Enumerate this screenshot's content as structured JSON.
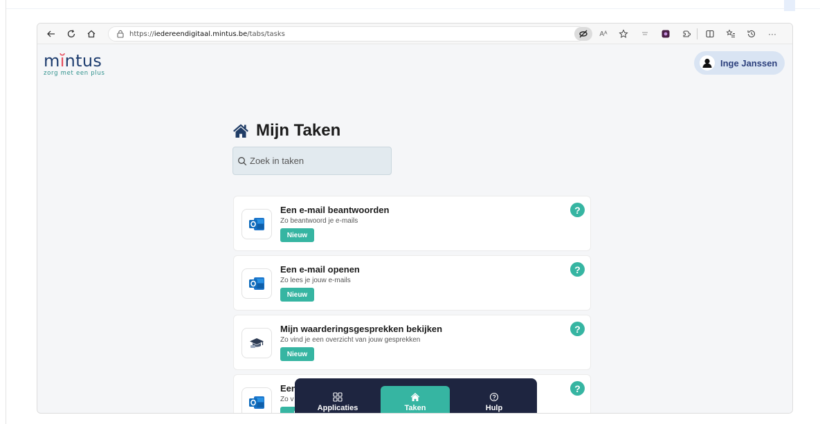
{
  "browser": {
    "url_prefix": "https://",
    "url_host": "iedereendigitaal.mintus.be",
    "url_path": "/tabs/tasks",
    "read_aloud_label": "Aᴬ",
    "more_label": "···"
  },
  "brand": {
    "logo_pre": "m",
    "logo_accent": "ĭ",
    "logo_post": "ntus",
    "tagline": "zorg met een plus",
    "navy": "#1d3c6e",
    "red": "#e64b5b",
    "teal": "#36b5a2"
  },
  "user": {
    "name": "Inge Janssen"
  },
  "page": {
    "title": "Mijn Taken",
    "search_placeholder": "Zoek in taken"
  },
  "tasks": [
    {
      "title": "Een e-mail beantwoorden",
      "subtitle": "Zo beantwoord je e-mails",
      "badge": "Nieuw",
      "icon": "outlook-icon"
    },
    {
      "title": "Een e-mail openen",
      "subtitle": "Zo lees je jouw e-mails",
      "badge": "Nieuw",
      "icon": "outlook-icon"
    },
    {
      "title": "Mijn waarderingsgesprekken bekijken",
      "subtitle": "Zo vind je een overzicht van jouw gesprekken",
      "badge": "Nieuw",
      "icon": "graduation-cap-icon"
    },
    {
      "title": "Een",
      "subtitle": "Zo v",
      "badge": "Ni",
      "icon": "outlook-icon"
    }
  ],
  "help_symbol": "?",
  "bottom_nav": [
    {
      "label": "Applicaties",
      "icon": "grid-icon",
      "active": false
    },
    {
      "label": "Taken",
      "icon": "home-icon",
      "active": true
    },
    {
      "label": "Hulp",
      "icon": "help-circle-icon",
      "active": false
    }
  ]
}
